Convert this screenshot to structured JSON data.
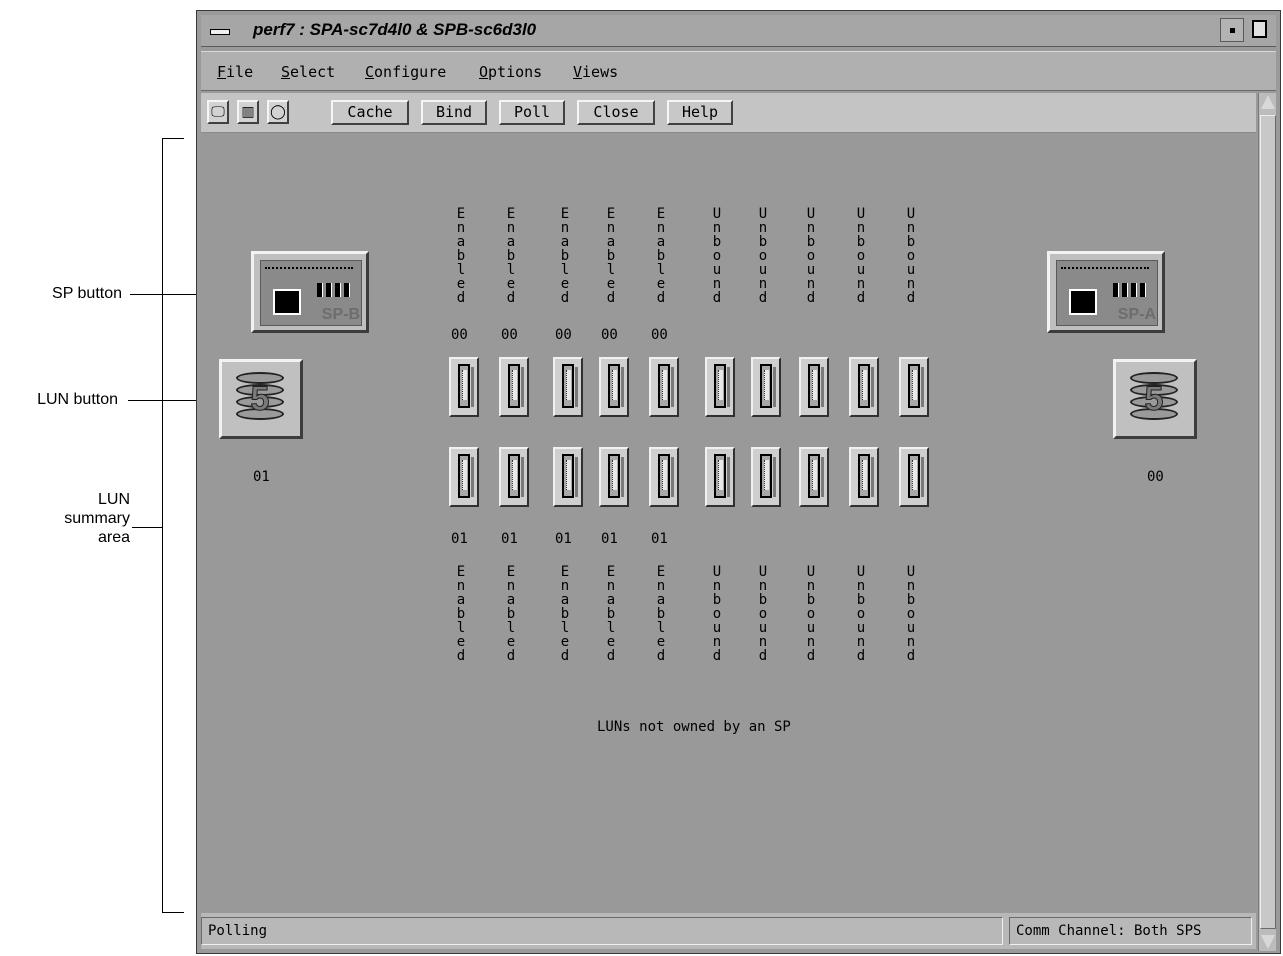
{
  "annotations": {
    "sp_button": "SP button",
    "lun_button": "LUN button",
    "lun_summary_area": [
      "LUN",
      "summary",
      "area"
    ]
  },
  "window": {
    "title": "perf7 : SPA-sc7d4l0 & SPB-sc6d3l0"
  },
  "menu": {
    "items": [
      {
        "label": "File",
        "mnemonic": "F"
      },
      {
        "label": "Select",
        "mnemonic": "S"
      },
      {
        "label": "Configure",
        "mnemonic": "C"
      },
      {
        "label": "Options",
        "mnemonic": "O"
      },
      {
        "label": "Views",
        "mnemonic": "V"
      }
    ]
  },
  "toolbar": {
    "icons": [
      "monitor-icon",
      "equipment-icon",
      "circle-icon"
    ],
    "buttons": [
      "Cache",
      "Bind",
      "Poll",
      "Close",
      "Help"
    ]
  },
  "sp_b": {
    "label": "SP-B"
  },
  "sp_a": {
    "label": "SP-A"
  },
  "lun_left": {
    "raid_level": "5",
    "id": "01"
  },
  "lun_right": {
    "raid_level": "5",
    "id": "00"
  },
  "top_row": {
    "statuses": [
      "Enabled",
      "Enabled",
      "Enabled",
      "Enabled",
      "Enabled",
      "Unbound",
      "Unbound",
      "Unbound",
      "Unbound",
      "Unbound"
    ],
    "luns": [
      "00",
      "00",
      "00",
      "00",
      "00",
      "",
      "",
      "",
      "",
      ""
    ]
  },
  "bottom_row": {
    "luns": [
      "01",
      "01",
      "01",
      "01",
      "01",
      "",
      "",
      "",
      "",
      ""
    ],
    "statuses": [
      "Enabled",
      "Enabled",
      "Enabled",
      "Enabled",
      "Enabled",
      "Unbound",
      "Unbound",
      "Unbound",
      "Unbound",
      "Unbound"
    ]
  },
  "unowned_label": "LUNs not owned by an SP",
  "status": {
    "left": "Polling",
    "right": "Comm Channel: Both SPS"
  }
}
